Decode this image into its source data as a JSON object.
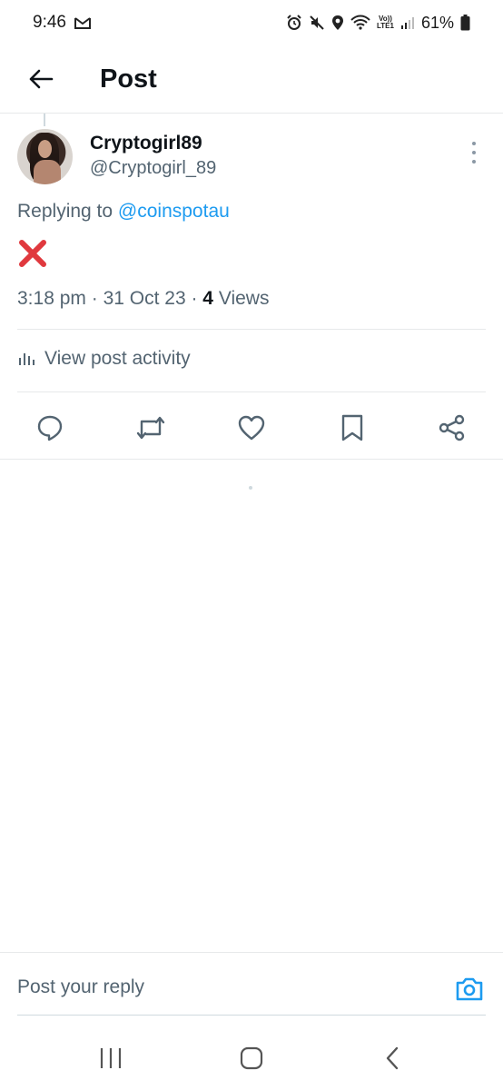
{
  "status_bar": {
    "time": "9:46",
    "battery": "61%",
    "volte_top": "Vo))",
    "volte_bottom": "LTE1"
  },
  "header": {
    "title": "Post"
  },
  "post": {
    "display_name": "Cryptogirl89",
    "handle": "@Cryptogirl_89",
    "replying_prefix": "Replying to ",
    "replying_mention": "@coinspotau",
    "content_emoji": "cross-mark-emoji",
    "time": "3:18 pm",
    "date": "31 Oct 23",
    "separator": " · ",
    "views_count": "4",
    "views_label": " Views",
    "activity_label": "View post activity"
  },
  "actions": [
    "reply-icon",
    "repost-icon",
    "like-icon",
    "bookmark-icon",
    "share-icon"
  ],
  "reply_bar": {
    "placeholder": "Post your reply"
  },
  "colors": {
    "accent": "#1d9bf0",
    "secondary_text": "#536471",
    "error_red": "#e0393e"
  }
}
